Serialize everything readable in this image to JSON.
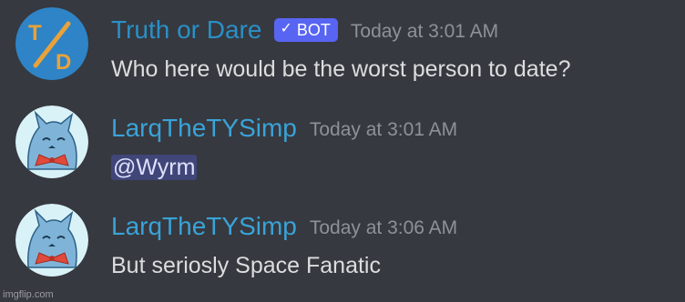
{
  "messages": [
    {
      "username": "Truth or Dare",
      "bot_tag": "BOT",
      "bot_check_icon": "✓",
      "timestamp": "Today at 3:01 AM",
      "text": "Who here would be the worst person to date?",
      "avatar": "truth-or-dare-logo"
    },
    {
      "username": "LarqTheTYSimp",
      "timestamp": "Today at 3:01 AM",
      "mention": "@Wyrm",
      "avatar": "furry-character-avatar"
    },
    {
      "username": "LarqTheTYSimp",
      "timestamp": "Today at 3:06 AM",
      "text": "But seriosly Space Fanatic",
      "avatar": "furry-character-avatar"
    }
  ],
  "watermark": "imgflip.com",
  "colors": {
    "background": "#36393f",
    "bot_tag": "#5865f2",
    "timestamp": "#8e9297",
    "message_text": "#dcddde",
    "truth_or_dare_avatar": "#2e84c6",
    "logo_orange": "#e8a23b"
  }
}
